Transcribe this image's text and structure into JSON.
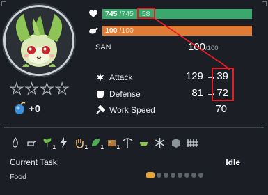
{
  "health": {
    "current": "745",
    "max": "/745",
    "extra": "58",
    "fill": 1.0,
    "color": "#3aa76d"
  },
  "hunger": {
    "current": "100",
    "max": "/100",
    "fill": 1.0,
    "color": "#e07b35"
  },
  "san": {
    "label": "SAN",
    "value": "100",
    "max": "/100"
  },
  "stars": {
    "filled": 0,
    "total": 4
  },
  "rank": "+0",
  "stats": {
    "attack": {
      "label": "Attack",
      "value": "129",
      "arrow": "→",
      "new_value": "39"
    },
    "defense": {
      "label": "Defense",
      "value": "81",
      "arrow": "→",
      "new_value": "72"
    },
    "work_speed": {
      "label": "Work Speed",
      "value": "70"
    }
  },
  "work_suitability": [
    {
      "icon": "flame-icon",
      "level": ""
    },
    {
      "icon": "watering-icon",
      "level": ""
    },
    {
      "icon": "sprout-icon",
      "level": "1"
    },
    {
      "icon": "lightning-icon",
      "level": ""
    },
    {
      "icon": "hand-icon",
      "level": "1"
    },
    {
      "icon": "leaf-icon",
      "level": "1"
    },
    {
      "icon": "lumber-icon",
      "level": "1"
    },
    {
      "icon": "pickaxe-icon",
      "level": ""
    },
    {
      "icon": "medicine-icon",
      "level": ""
    },
    {
      "icon": "snowflake-icon",
      "level": ""
    },
    {
      "icon": "transport-icon",
      "level": ""
    },
    {
      "icon": "farm-icon",
      "level": ""
    }
  ],
  "task": {
    "label": "Current Task:",
    "value": "Idle"
  },
  "food": {
    "label": "Food",
    "filled": 1,
    "total": 8
  },
  "colors": {
    "highlight": "#e21f26",
    "health": "#3aa76d",
    "hunger": "#e07b35"
  }
}
